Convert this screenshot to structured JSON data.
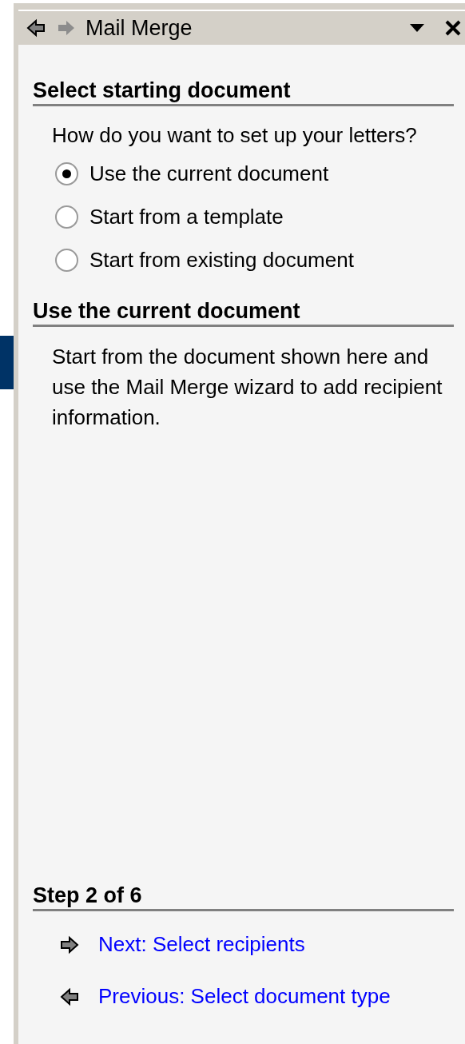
{
  "title_bar": {
    "title": "Mail Merge",
    "nav": [
      {
        "kind": "back",
        "disabled": false
      },
      {
        "kind": "forward",
        "disabled": true
      }
    ]
  },
  "sections": [
    {
      "heading": "Select starting document",
      "question": "How do you want to set up your letters?",
      "options": [
        {
          "label": "Use the current document",
          "selected": true
        },
        {
          "label": "Start from a template",
          "selected": false
        },
        {
          "label": "Start from existing document",
          "selected": false
        }
      ]
    },
    {
      "heading": "Use the current document",
      "text": "Start from the document shown here and use the Mail Merge wizard to add recipient information."
    }
  ],
  "step": {
    "heading": "Step 2 of 6",
    "links": [
      {
        "kind": "next",
        "label": "Next: Select recipients"
      },
      {
        "kind": "previous",
        "label": "Previous: Select document type"
      }
    ]
  }
}
